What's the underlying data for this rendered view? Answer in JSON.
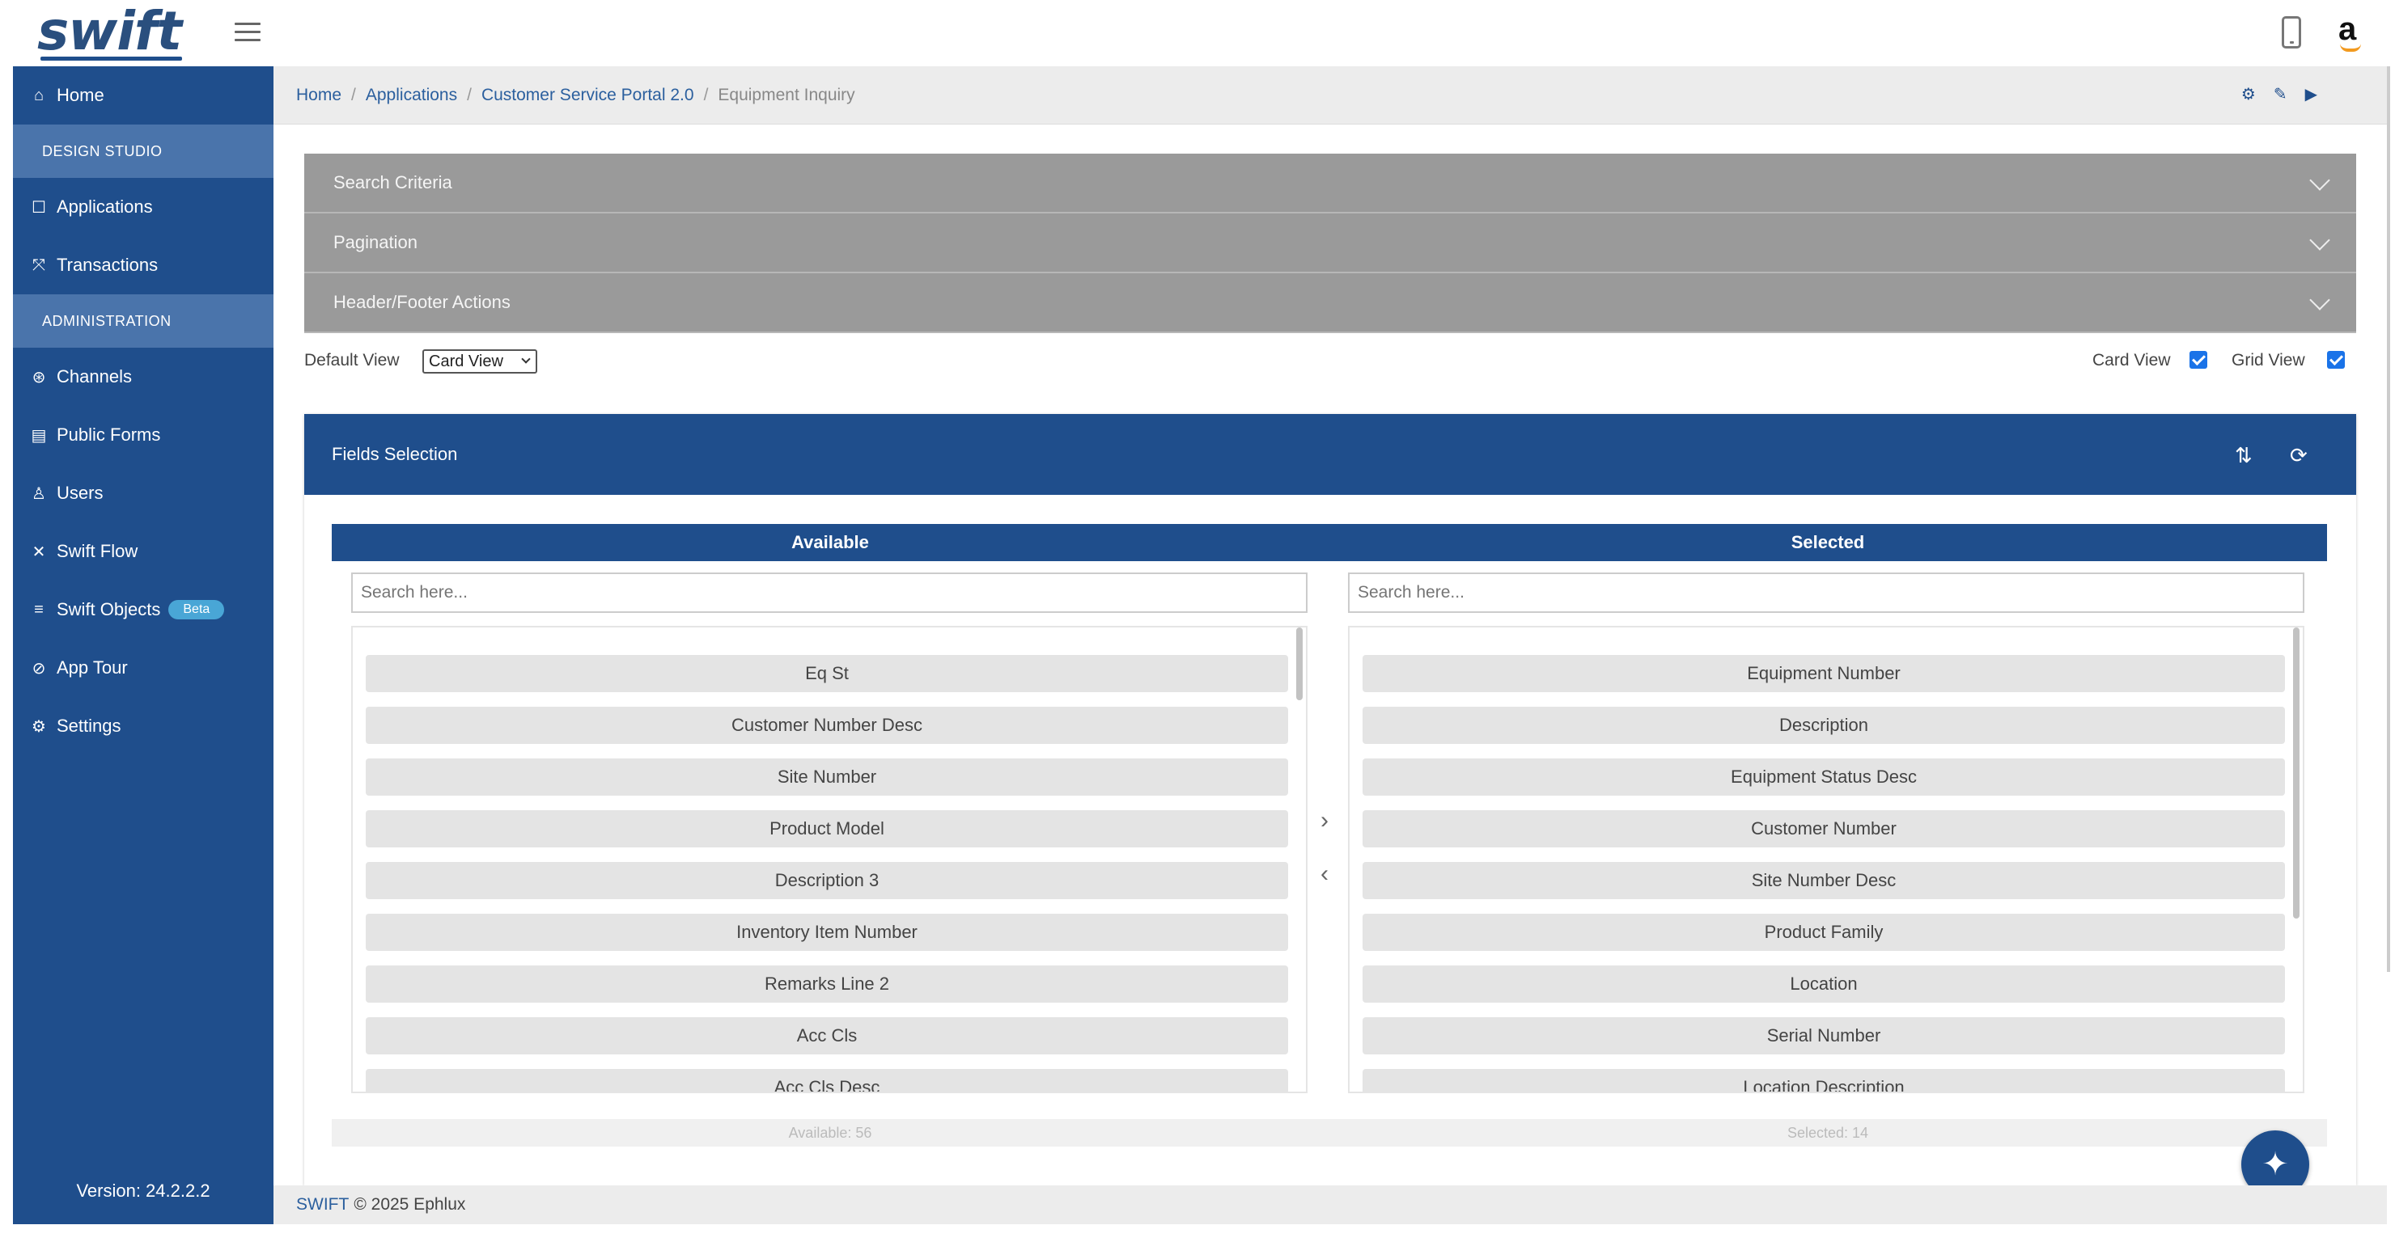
{
  "app": {
    "logo": "swift"
  },
  "sidebar": {
    "items": [
      {
        "label": "Home",
        "icon": "home-icon",
        "glyph": "⌂"
      },
      {
        "section": "DESIGN STUDIO"
      },
      {
        "label": "Applications",
        "icon": "applications-icon",
        "glyph": "☐"
      },
      {
        "label": "Transactions",
        "icon": "transactions-icon",
        "glyph": "⤧"
      },
      {
        "section": "ADMINISTRATION"
      },
      {
        "label": "Channels",
        "icon": "channels-icon",
        "glyph": "⊛"
      },
      {
        "label": "Public Forms",
        "icon": "public-forms-icon",
        "glyph": "▤"
      },
      {
        "label": "Users",
        "icon": "users-icon",
        "glyph": "♙"
      },
      {
        "label": "Swift Flow",
        "icon": "swift-flow-icon",
        "glyph": "✕"
      },
      {
        "label": "Swift Objects",
        "icon": "swift-objects-icon",
        "glyph": "≡",
        "badge": "Beta"
      },
      {
        "label": "App Tour",
        "icon": "app-tour-icon",
        "glyph": "⊘"
      },
      {
        "label": "Settings",
        "icon": "settings-icon",
        "glyph": "⚙"
      }
    ],
    "version": "Version: 24.2.2.2"
  },
  "breadcrumb": {
    "items": [
      "Home",
      "Applications",
      "Customer Service Portal 2.0"
    ],
    "current": "Equipment Inquiry"
  },
  "accordions": [
    "Search Criteria",
    "Pagination",
    "Header/Footer Actions"
  ],
  "view_options": {
    "default_view_label": "Default View",
    "default_view_value": "Card View",
    "card_view_label": "Card View",
    "card_view_checked": true,
    "grid_view_label": "Grid View",
    "grid_view_checked": true
  },
  "fields_selection": {
    "title": "Fields Selection",
    "available": {
      "header": "Available",
      "search_placeholder": "Search here...",
      "items": [
        "Eq St",
        "Customer Number Desc",
        "Site Number",
        "Product Model",
        "Description 3",
        "Inventory Item Number",
        "Remarks Line 2",
        "Acc Cls",
        "Acc Cls Desc"
      ],
      "count_label": "Available: 56"
    },
    "selected": {
      "header": "Selected",
      "search_placeholder": "Search here...",
      "items": [
        "Equipment Number",
        "Description",
        "Equipment Status Desc",
        "Customer Number",
        "Site Number Desc",
        "Product Family",
        "Location",
        "Serial Number",
        "Location Description"
      ],
      "count_label": "Selected: 14"
    }
  },
  "footer": {
    "brand": "SWIFT",
    "text": "© 2025 Ephlux"
  },
  "colors": {
    "primary": "#1f4e8c",
    "section": "#4a74ab",
    "accordion": "#9a9a9a",
    "beta": "#49a6d6"
  }
}
